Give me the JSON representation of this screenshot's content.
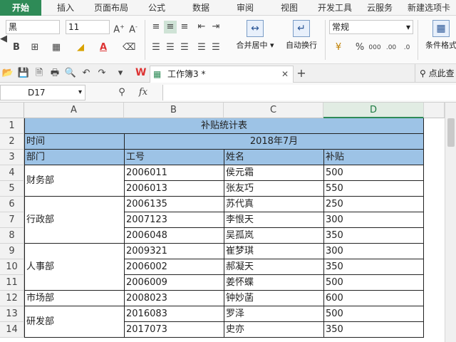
{
  "ribbon_tabs": [
    "开始",
    "插入",
    "页面布局",
    "公式",
    "数据",
    "审阅",
    "视图",
    "开发工具",
    "云服务",
    "新建选项卡"
  ],
  "active_tab": "开始",
  "ribbon": {
    "font_name": "黑",
    "font_size": "11",
    "number_format": "常规",
    "merge_center_label": "合并居中",
    "wrap_text_label": "自动换行",
    "conditional_format_label": "条件格式",
    "percent": "%",
    "thousands": "000"
  },
  "document": {
    "tab_title": "工作簿3 *",
    "search_placeholder": "点此查"
  },
  "formula_bar": {
    "cell_ref": "D17",
    "fx_label": "fx",
    "value": ""
  },
  "grid": {
    "columns": [
      "A",
      "B",
      "C",
      "D"
    ],
    "selected_column": "D",
    "row_numbers": [
      "1",
      "2",
      "3",
      "4",
      "5",
      "6",
      "7",
      "8",
      "9",
      "10",
      "11",
      "12",
      "13",
      "14"
    ]
  },
  "table": {
    "title": "补贴统计表",
    "period_label": "时间",
    "period_value": "2018年7月",
    "headers": [
      "部门",
      "工号",
      "姓名",
      "补贴"
    ],
    "departments": [
      "财务部",
      "行政部",
      "人事部",
      "市场部",
      "研发部"
    ],
    "rows": [
      [
        "2006011",
        "侯元霜",
        "500"
      ],
      [
        "2006013",
        "张友巧",
        "550"
      ],
      [
        "2006135",
        "苏代真",
        "250"
      ],
      [
        "2007123",
        "李恨天",
        "300"
      ],
      [
        "2006048",
        "吴孤岚",
        "350"
      ],
      [
        "2009321",
        "崔梦琪",
        "300"
      ],
      [
        "2006002",
        "郝凝天",
        "350"
      ],
      [
        "2006009",
        "姜怀蝶",
        "500"
      ],
      [
        "2008023",
        "钟妙菡",
        "600"
      ],
      [
        "2016083",
        "罗泽",
        "500"
      ],
      [
        "2017073",
        "史亦",
        "350"
      ]
    ]
  },
  "colors": {
    "accent": "#2e8b57",
    "header_fill": "#9dc3e6",
    "wps_red": "#d33"
  }
}
